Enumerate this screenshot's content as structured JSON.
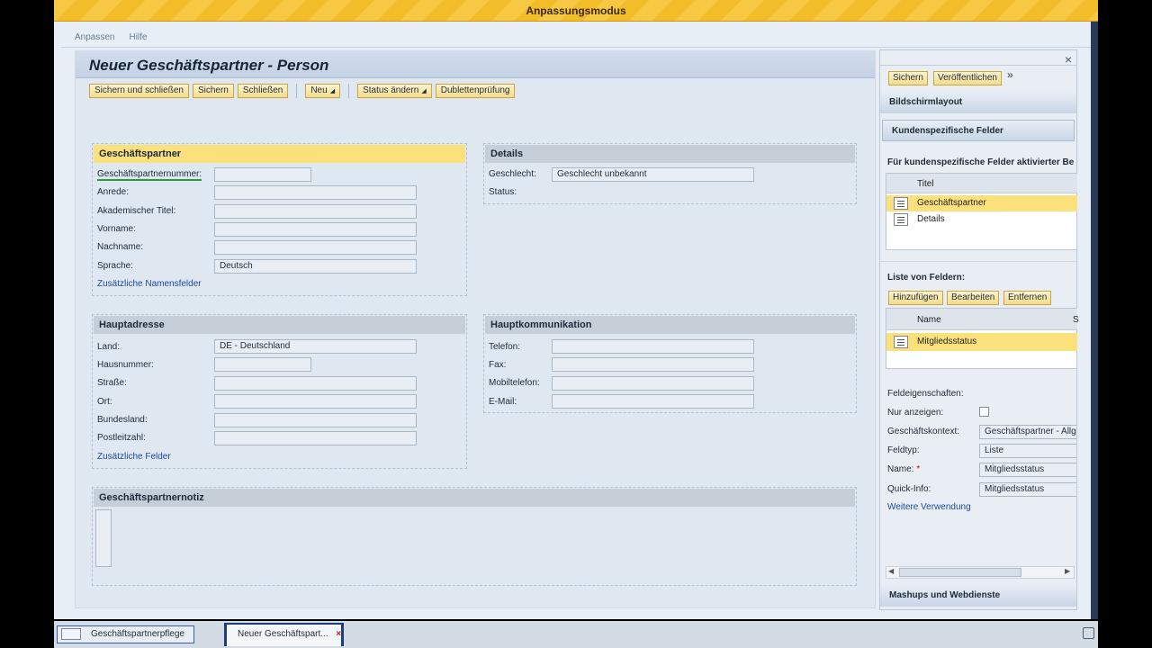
{
  "banner": {
    "title": "Anpassungsmodus"
  },
  "menu": {
    "customize": "Anpassen",
    "help": "Hilfe"
  },
  "main": {
    "title": "Neuer Geschäftspartner - Person",
    "toolbar": {
      "save_close": "Sichern und schließen",
      "save": "Sichern",
      "close": "Schließen",
      "new": "Neu",
      "change_status": "Status ändern",
      "duplicate_check": "Dublettenprüfung"
    },
    "partner": {
      "header": "Geschäftspartner",
      "number_label": "Geschäftspartnernummer:",
      "salutation_label": "Anrede:",
      "academic_title_label": "Akademischer Titel:",
      "first_name_label": "Vorname:",
      "last_name_label": "Nachname:",
      "language_label": "Sprache:",
      "language_value": "Deutsch",
      "more_names_link": "Zusätzliche Namensfelder"
    },
    "details": {
      "header": "Details",
      "gender_label": "Geschlecht:",
      "gender_value": "Geschlecht unbekannt",
      "status_label": "Status:"
    },
    "address": {
      "header": "Hauptadresse",
      "country_label": "Land:",
      "country_value": "DE - Deutschland",
      "house_number_label": "Hausnummer:",
      "street_label": "Straße:",
      "city_label": "Ort:",
      "state_label": "Bundesland:",
      "postal_code_label": "Postleitzahl:",
      "more_fields_link": "Zusätzliche Felder"
    },
    "communication": {
      "header": "Hauptkommunikation",
      "phone_label": "Telefon:",
      "fax_label": "Fax:",
      "mobile_label": "Mobiltelefon:",
      "email_label": "E-Mail:"
    },
    "note": {
      "header": "Geschäftspartnernotiz"
    }
  },
  "panel": {
    "save": "Sichern",
    "publish": "Veröffentlichen",
    "more": "»",
    "close": "×",
    "screen_layout": "Bildschirmlayout",
    "custom_fields": "Kundenspezifische Felder",
    "activated_for": "Für kundenspezifische Felder aktivierter Be",
    "col_title": "Titel",
    "sections": [
      {
        "title": "Geschäftspartner",
        "icon": "section-icon"
      },
      {
        "title": "Details",
        "icon": "section-icon"
      }
    ],
    "field_list_label": "Liste von Feldern:",
    "add": "Hinzufügen",
    "edit": "Bearbeiten",
    "remove": "Entfernen",
    "col_name": "Name",
    "col_s": "S",
    "fields": [
      {
        "name": "Mitgliedsstatus",
        "icon": "field-icon"
      }
    ],
    "props_label": "Feldeigenschaften:",
    "display_only_label": "Nur anzeigen:",
    "context_label": "Geschäftskontext:",
    "context_value": "Geschäftspartner - Allg",
    "type_label": "Feldtyp:",
    "type_value": "Liste",
    "name_label": "Name:",
    "name_required": "*",
    "name_value": "Mitgliedsstatus",
    "quickinfo_label": "Quick-Info:",
    "quickinfo_value": "Mitgliedsstatus",
    "further_usage": "Weitere Verwendung",
    "mashups": "Mashups und Webdienste"
  },
  "taskbar": {
    "tab1": "Geschäftspartnerpflege",
    "tab2": "Neuer Geschäftspart...",
    "tab2_close": "×"
  },
  "colors": {
    "accent_yellow": "#fbe07c",
    "link_blue": "#1b4a9a",
    "banner_yellow": "#f6c844"
  }
}
